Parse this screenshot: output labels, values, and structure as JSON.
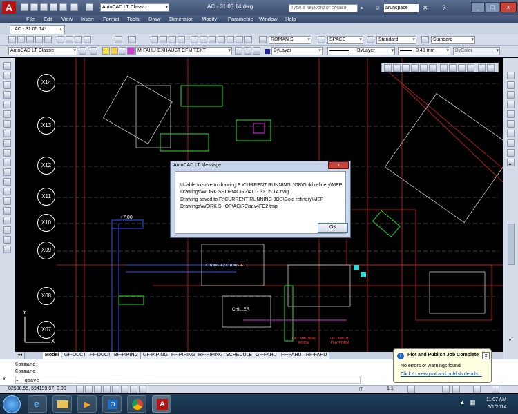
{
  "app": {
    "title": "AC - 31.05.14.dwg",
    "workspace": "AutoCAD LT Classic",
    "search_placeholder": "Type a keyword or phrase",
    "user": "arunspace",
    "window_controls": [
      "_",
      "□",
      "x"
    ]
  },
  "menu": [
    "File",
    "Edit",
    "View",
    "Insert",
    "Format",
    "Tools",
    "Draw",
    "Dimension",
    "Modify",
    "Parametric",
    "Window",
    "Help"
  ],
  "document_tab": "AC - 31.05.14*",
  "toolbar1": {
    "text_style": "ROMAN S",
    "dim_style": "SPACE",
    "table_style": "Standard",
    "multileader_style": "Standard"
  },
  "toolbar2": {
    "workspace": "AutoCAD LT Classic",
    "layer": "M-FAHU-EXHAUST CFM TEXT",
    "color": "ByLayer",
    "linetype": "ByLayer",
    "lineweight": "0.40 mm",
    "plotstyle": "ByColor"
  },
  "grid_labels": [
    "X14",
    "X13",
    "X12",
    "X11",
    "X10",
    "X09",
    "X08",
    "X07"
  ],
  "drawing_labels": {
    "chiller": "CHILLER",
    "c_tower_1": "C TOWER-1",
    "c_tower_2": "C TOWER-2",
    "elevation": "+7.00",
    "lift_room": "LIFT MACHINE ROOM",
    "lift_platform": "LIFT MACH. PLATFORM"
  },
  "ucs": {
    "x": "X",
    "y": "Y"
  },
  "layout_tabs": [
    "Model",
    "GF-DUCT",
    "FF-DUCT",
    "BF-PIPING",
    "GF-PIPING",
    "FF-PIPING",
    "RF-PIPING",
    "SCHEDULE",
    "GF-FAHU",
    "FF-FAHU",
    "RF-FAHU"
  ],
  "command": {
    "line1": "Command:",
    "line2": "Command:",
    "prompt": "_qsave"
  },
  "status": {
    "coordinates": "82588.55, 594199.97, 0.00",
    "scale": "1:1"
  },
  "dialog": {
    "title": "AutoCAD LT Message",
    "line1": "Unable to save to drawing F:\\CURRENT RUNNING JOB\\Gold refinery\\MEP",
    "line2": "Drawings\\WORK SHOP\\AC\\R3\\AC - 31.05.14.dwg.",
    "line3": "Drawing saved to F:\\CURRENT RUNNING JOB\\Gold refinery\\MEP",
    "line4": "Drawings\\WORK SHOP\\AC\\R3\\sav4FD2.tmp",
    "ok_label": "OK",
    "close_label": "x"
  },
  "balloon": {
    "title": "Plot and Publish Job Complete",
    "message": "No errors or warnings found",
    "link": "Click to view plot and publish details...",
    "close_label": "x"
  },
  "clock": {
    "time": "11:07 AM",
    "date": "6/1/2014"
  },
  "colors": {
    "titlebar": "#3b4d6e",
    "cad_background": "#000000",
    "dialog_frame": "#c6d5ea",
    "balloon_bg": "#ffffe1",
    "link": "#0645ad"
  }
}
